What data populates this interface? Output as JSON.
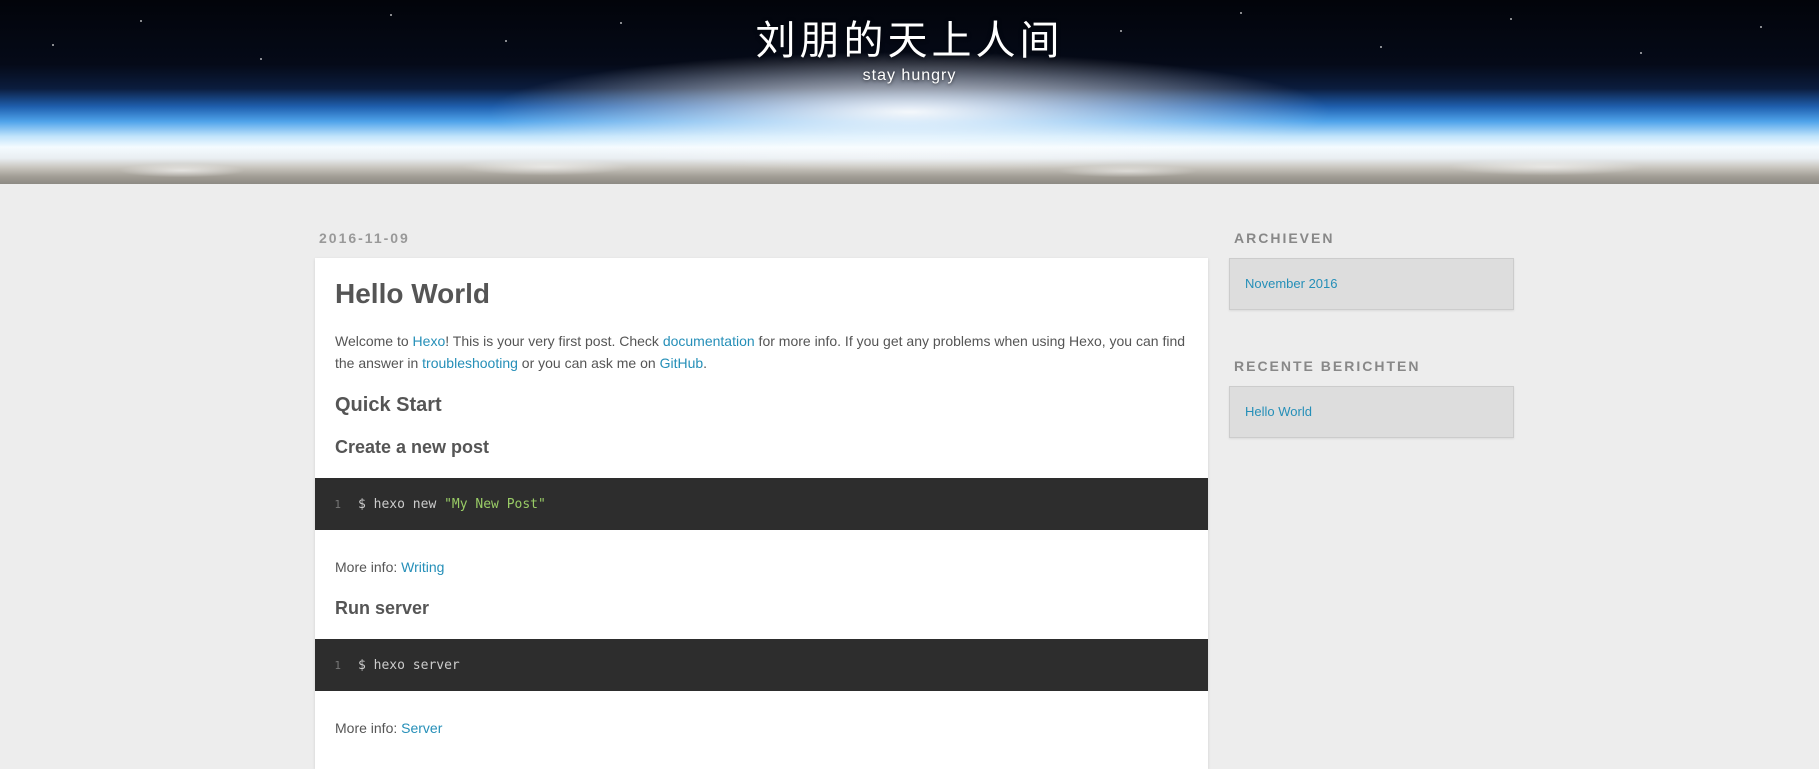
{
  "header": {
    "title": "刘朋的天上人间",
    "subtitle": "stay hungry"
  },
  "post": {
    "date": "2016-11-09",
    "title": "Hello World",
    "intro": {
      "t1": "Welcome to ",
      "l1": "Hexo",
      "t2": "! This is your very first post. Check ",
      "l2": "documentation",
      "t3": " for more info. If you get any problems when using Hexo, you can find the answer in ",
      "l3": "troubleshooting",
      "t4": " or you can ask me on ",
      "l4": "GitHub",
      "t5": "."
    },
    "quick_start": "Quick Start",
    "sections": [
      {
        "heading": "Create a new post",
        "code_line": "1",
        "code_cmd": "$ hexo new ",
        "code_str": "\"My New Post\"",
        "more_prefix": "More info: ",
        "more_link": "Writing"
      },
      {
        "heading": "Run server",
        "code_line": "1",
        "code_cmd": "$ hexo server",
        "code_str": "",
        "more_prefix": "More info: ",
        "more_link": "Server"
      }
    ]
  },
  "sidebar": {
    "archives_title": "ARCHIEVEN",
    "archives_item": "November 2016",
    "recent_title": "RECENTE BERICHTEN",
    "recent_item": "Hello World"
  },
  "colors": {
    "link": "#258fb8",
    "code_bg": "#2d2d2d",
    "code_string": "#99cc66",
    "page_bg": "#ededed"
  }
}
